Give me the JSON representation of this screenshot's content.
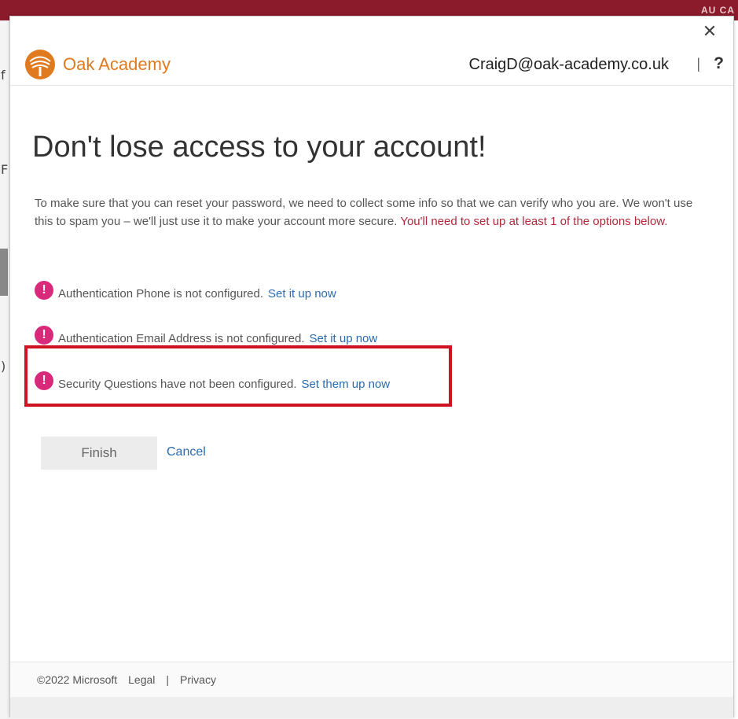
{
  "background": {
    "topbar_text": "AU CA",
    "left_glyphs": [
      "f",
      "F",
      ")"
    ]
  },
  "dialog": {
    "close_label": "✕",
    "header": {
      "brand": "Oak Academy",
      "user_email": "CraigD@oak-academy.co.uk",
      "divider": "|",
      "help_label": "?"
    },
    "title": "Don't lose access to your account!",
    "intro": "To make sure that you can reset your password, we need to collect some info so that we can verify who you are. We won't use this to spam you – we'll just use it to make your account more secure.",
    "intro_warning": "You'll need to set up at least 1 of the options below.",
    "items": [
      {
        "text": "Authentication Phone is not configured.",
        "link": "Set it up now"
      },
      {
        "text": "Authentication Email Address is not configured.",
        "link": "Set it up now"
      },
      {
        "text": "Security Questions have not been configured.",
        "link": "Set them up now"
      }
    ],
    "alert_glyph": "!",
    "finish_label": "Finish",
    "cancel_label": "Cancel",
    "footer": {
      "copyright": "©2022 Microsoft",
      "legal": "Legal",
      "separator": "|",
      "privacy": "Privacy"
    }
  },
  "colors": {
    "brand_orange": "#e07a1f",
    "warning_red": "#b1293b",
    "alert_pink": "#d9297b",
    "link_blue": "#2a6bb1",
    "highlight_red": "#d0111f"
  }
}
